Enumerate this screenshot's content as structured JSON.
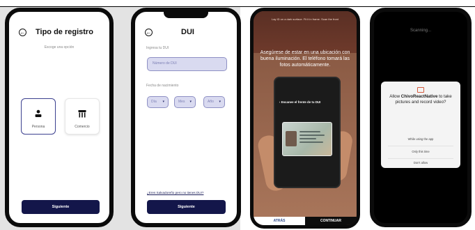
{
  "screen1": {
    "title": "Tipo de registro",
    "subtitle": "Escoge una opción",
    "option_persona": "Persona",
    "option_comercio": "Comercio",
    "next_button": "Siguiente"
  },
  "screen2": {
    "title": "DUI",
    "dui_label": "Ingresa tu DUI",
    "dui_placeholder": "Número de DUI",
    "birth_label": "Fecha de nacimiento",
    "day": "Día",
    "month": "Mes",
    "year": "Año",
    "no_dui_link": "¿Eres Salvadoreño pero no tienes DUI?",
    "next_button": "Siguiente"
  },
  "screen3": {
    "hint": "Lay ID on a dark surface. Fit it in frame. Scan the front",
    "instruction": "Asegúrese de estar en una ubicación con buena iluminación. El teléfono tomará las fotos automáticamente.",
    "inner_title": "Escanee el frente de tu DUI",
    "back_button": "ATRÁS",
    "continue_button": "CONTINUAR"
  },
  "screen4": {
    "scanning": "Scanning...",
    "dialog_prefix": "Allow ",
    "app_name": "ChivoReactNative",
    "dialog_suffix": " to take pictures and record video?",
    "option_while_using": "While using the app",
    "option_only_this_time": "Only this time",
    "option_dont_allow": "Don't allow"
  },
  "colors": {
    "primary": "#13164a",
    "field_bg": "#d9daf0",
    "field_border": "#8e90c4",
    "accent_camera": "#d35a3d"
  }
}
